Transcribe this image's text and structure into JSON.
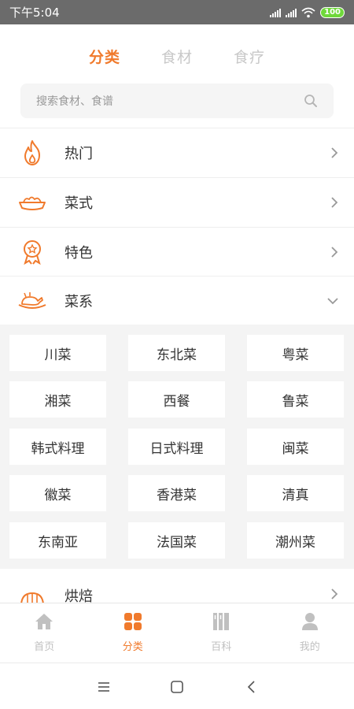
{
  "status": {
    "time": "下午5:04",
    "battery": "100"
  },
  "top_tabs": [
    {
      "label": "分类",
      "active": true
    },
    {
      "label": "食材",
      "active": false
    },
    {
      "label": "食疗",
      "active": false
    }
  ],
  "search": {
    "placeholder": "搜索食材、食谱",
    "icon": "search-icon"
  },
  "categories": [
    {
      "label": "热门",
      "icon": "flame-icon",
      "expanded": false
    },
    {
      "label": "菜式",
      "icon": "dish-icon",
      "expanded": false
    },
    {
      "label": "特色",
      "icon": "badge-icon",
      "expanded": false
    },
    {
      "label": "菜系",
      "icon": "roast-chicken-icon",
      "expanded": true
    },
    {
      "label": "烘焙",
      "icon": "bread-icon",
      "expanded": false
    }
  ],
  "cuisines": [
    "川菜",
    "东北菜",
    "粤菜",
    "湘菜",
    "西餐",
    "鲁菜",
    "韩式料理",
    "日式料理",
    "闽菜",
    "徽菜",
    "香港菜",
    "清真",
    "东南亚",
    "法国菜",
    "潮州菜"
  ],
  "tabbar": [
    {
      "label": "首页",
      "icon": "home-icon",
      "active": false
    },
    {
      "label": "分类",
      "icon": "grid-icon",
      "active": true
    },
    {
      "label": "百科",
      "icon": "books-icon",
      "active": false
    },
    {
      "label": "我的",
      "icon": "user-icon",
      "active": false
    }
  ],
  "colors": {
    "accent": "#f07a2c",
    "inactive": "#c0c0c0",
    "status_bar": "#6b6b6b"
  }
}
